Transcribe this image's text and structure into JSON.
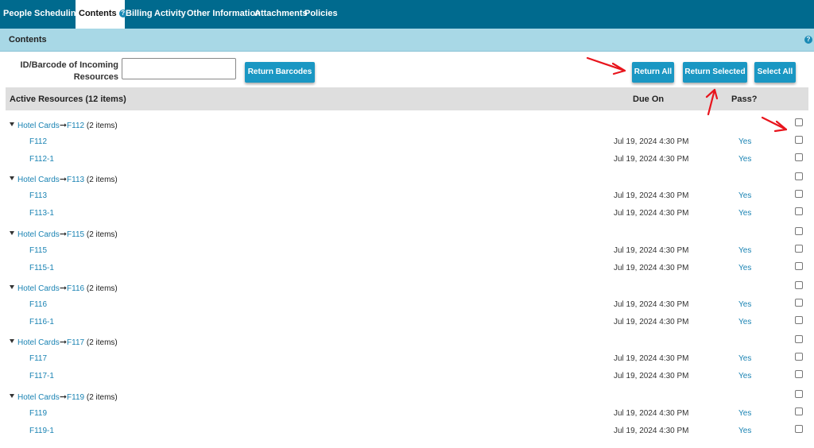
{
  "nav": {
    "tabs": [
      {
        "label": "People"
      },
      {
        "label": "Scheduling"
      },
      {
        "label": "Contents",
        "active": true
      },
      {
        "label": "Billing"
      },
      {
        "label": "Activity"
      },
      {
        "label": "Other Information"
      },
      {
        "label": "Attachments"
      },
      {
        "label": "Policies"
      }
    ],
    "help_glyph": "?"
  },
  "section": {
    "title": "Contents",
    "help_glyph": "?"
  },
  "barcode": {
    "label": "ID/Barcode of Incoming Resources",
    "value": "",
    "return_barcodes_label": "Return Barcodes"
  },
  "actions": {
    "return_all": "Return All",
    "return_selected": "Return Selected",
    "select_all": "Select All"
  },
  "table": {
    "header_label": "Active Resources (12 items)",
    "due_header": "Due On",
    "pass_header": "Pass?",
    "arrow": "➞",
    "groups": [
      {
        "parent": "Hotel Cards",
        "child": "F112",
        "count": "(2 items)",
        "items": [
          {
            "name": "F112",
            "due": "Jul 19, 2024 4:30 PM",
            "pass": "Yes"
          },
          {
            "name": "F112-1",
            "due": "Jul 19, 2024 4:30 PM",
            "pass": "Yes"
          }
        ]
      },
      {
        "parent": "Hotel Cards",
        "child": "F113",
        "count": "(2 items)",
        "items": [
          {
            "name": "F113",
            "due": "Jul 19, 2024 4:30 PM",
            "pass": "Yes"
          },
          {
            "name": "F113-1",
            "due": "Jul 19, 2024 4:30 PM",
            "pass": "Yes"
          }
        ]
      },
      {
        "parent": "Hotel Cards",
        "child": "F115",
        "count": "(2 items)",
        "items": [
          {
            "name": "F115",
            "due": "Jul 19, 2024 4:30 PM",
            "pass": "Yes"
          },
          {
            "name": "F115-1",
            "due": "Jul 19, 2024 4:30 PM",
            "pass": "Yes"
          }
        ]
      },
      {
        "parent": "Hotel Cards",
        "child": "F116",
        "count": "(2 items)",
        "items": [
          {
            "name": "F116",
            "due": "Jul 19, 2024 4:30 PM",
            "pass": "Yes"
          },
          {
            "name": "F116-1",
            "due": "Jul 19, 2024 4:30 PM",
            "pass": "Yes"
          }
        ]
      },
      {
        "parent": "Hotel Cards",
        "child": "F117",
        "count": "(2 items)",
        "items": [
          {
            "name": "F117",
            "due": "Jul 19, 2024 4:30 PM",
            "pass": "Yes"
          },
          {
            "name": "F117-1",
            "due": "Jul 19, 2024 4:30 PM",
            "pass": "Yes"
          }
        ]
      },
      {
        "parent": "Hotel Cards",
        "child": "F119",
        "count": "(2 items)",
        "items": [
          {
            "name": "F119",
            "due": "Jul 19, 2024 4:30 PM",
            "pass": "Yes"
          },
          {
            "name": "F119-1",
            "due": "Jul 19, 2024 4:30 PM",
            "pass": "Yes"
          }
        ]
      }
    ]
  },
  "colors": {
    "nav_bg": "#006a8e",
    "section_bg": "#a8d8e6",
    "button_bg": "#1a97c3",
    "link": "#1a83b3",
    "annotation": "#e8141c"
  }
}
